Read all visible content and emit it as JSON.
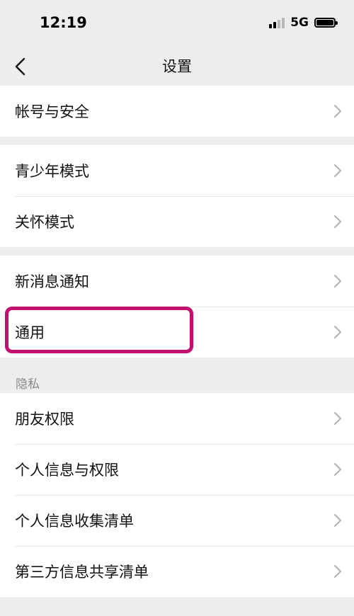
{
  "status_bar": {
    "time": "12:19",
    "network": "5G",
    "signal_bars": 4,
    "signal_active_bars": 2
  },
  "nav": {
    "title": "设置"
  },
  "sections": [
    {
      "rows": [
        {
          "label": "帐号与安全"
        }
      ]
    },
    {
      "rows": [
        {
          "label": "青少年模式"
        },
        {
          "label": "关怀模式"
        }
      ]
    },
    {
      "rows": [
        {
          "label": "新消息通知"
        },
        {
          "label": "通用"
        }
      ]
    },
    {
      "header": "隐私",
      "rows": [
        {
          "label": "朋友权限"
        },
        {
          "label": "个人信息与权限"
        },
        {
          "label": "个人信息收集清单"
        },
        {
          "label": "第三方信息共享清单"
        }
      ]
    }
  ],
  "highlight": {
    "target": "通用",
    "color": "#c1106d"
  },
  "colors": {
    "background": "#ededed",
    "row": "#ffffff",
    "divider": "#e6e6e6",
    "chevron": "#b2b2b2",
    "group_label": "#8a8a8a"
  }
}
